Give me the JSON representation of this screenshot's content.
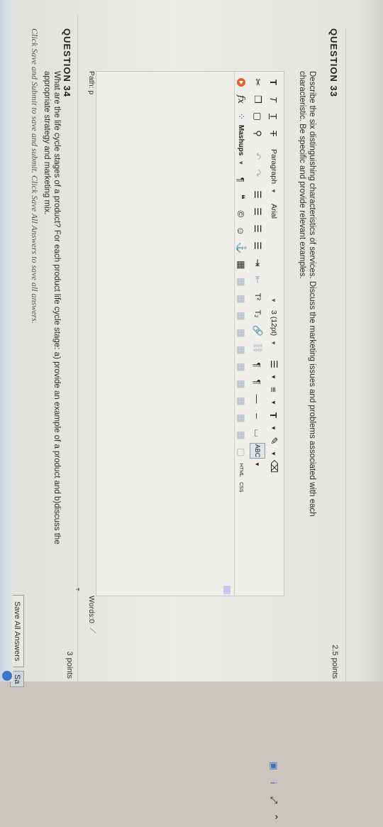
{
  "q33": {
    "header": "QUESTION 33",
    "points": "2.5 points",
    "prompt_line1": "Describe the six distinguishing characteristics of services. Discuss the marketing issues and problems  associated with each",
    "prompt_line2": "characteristic. Be specific and provide relevant examples."
  },
  "toolbar": {
    "paragraph": "Paragraph",
    "font": "Arial",
    "size": "3 (12pt)",
    "mashups": "Mashups",
    "html_label": "HTML",
    "css_label": "CSS"
  },
  "editor": {
    "path": "Path: p",
    "words": "Words:0"
  },
  "q34": {
    "header": "QUESTION 34",
    "points": "3 points",
    "prompt_line1": "What are the life cycle stages of a product? For each product life cycle stage: a) provide an example of a product and b)discuss the",
    "prompt_line2": "appropriate strategy and marketing mix."
  },
  "footer": {
    "instruction": "Click Save and Submit to save and submit. Click Save All Answers to save all answers.",
    "save_all": "Save All Answers",
    "save_submit": "Sa"
  },
  "colors": {
    "accent": "#6b8fc7",
    "orange": "#e8622c",
    "blue_icon": "#3c6fb5"
  }
}
